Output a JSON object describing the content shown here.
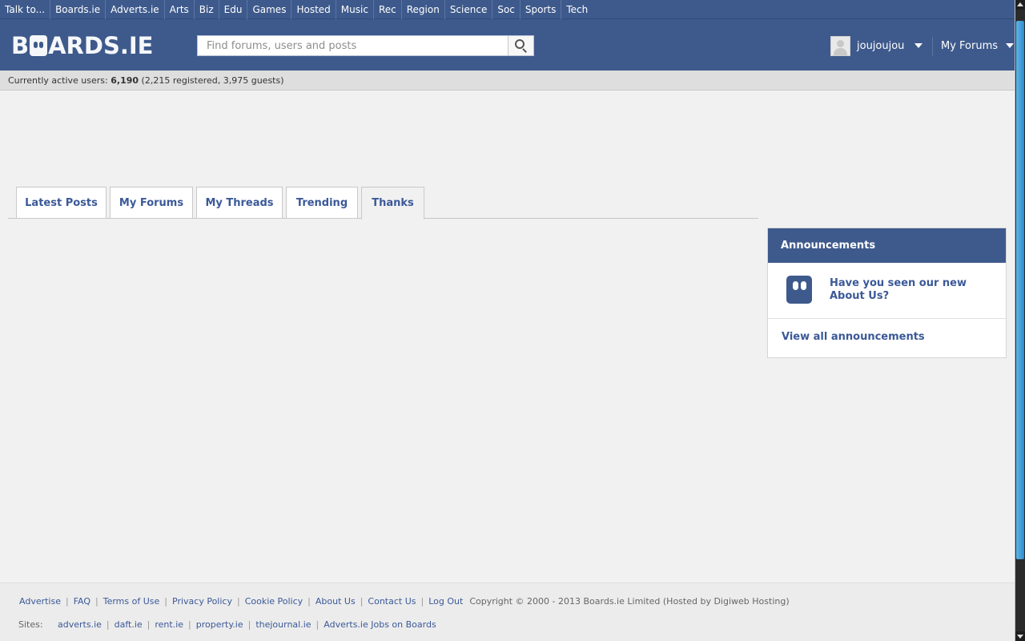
{
  "topnav": {
    "items": [
      "Talk to...",
      "Boards.ie",
      "Adverts.ie",
      "Arts",
      "Biz",
      "Edu",
      "Games",
      "Hosted",
      "Music",
      "Rec",
      "Region",
      "Science",
      "Soc",
      "Sports",
      "Tech"
    ]
  },
  "header": {
    "logo_text": "BOARDS.IE",
    "search_placeholder": "Find forums, users and posts",
    "search_value": "",
    "username": "joujoujou",
    "myforums_label": "My Forums"
  },
  "active_users": {
    "prefix": "Currently active users: ",
    "total": "6,190",
    "detail": " (2,215 registered, 3,975 guests)"
  },
  "tabs": [
    {
      "label": "Latest Posts",
      "active": false
    },
    {
      "label": "My Forums",
      "active": false
    },
    {
      "label": "My Threads",
      "active": false
    },
    {
      "label": "Trending",
      "active": false
    },
    {
      "label": "Thanks",
      "active": true
    }
  ],
  "announcements": {
    "title": "Announcements",
    "item_text": "Have you seen our new About Us?",
    "view_all": "View all announcements"
  },
  "footer": {
    "links": [
      "Advertise",
      "FAQ",
      "Terms of Use",
      "Privacy Policy",
      "Cookie Policy",
      "About Us",
      "Contact Us",
      "Log Out"
    ],
    "copyright": "Copyright © 2000 - 2013 Boards.ie Limited (Hosted by Digiweb Hosting)",
    "sites_label": "Sites:",
    "sites": [
      "adverts.ie",
      "daft.ie",
      "rent.ie",
      "property.ie",
      "thejournal.ie",
      "Adverts.ie Jobs on Boards"
    ]
  },
  "colors": {
    "brand": "#3e5a8c",
    "link": "#3b5998",
    "background": "#f1f1f1"
  }
}
